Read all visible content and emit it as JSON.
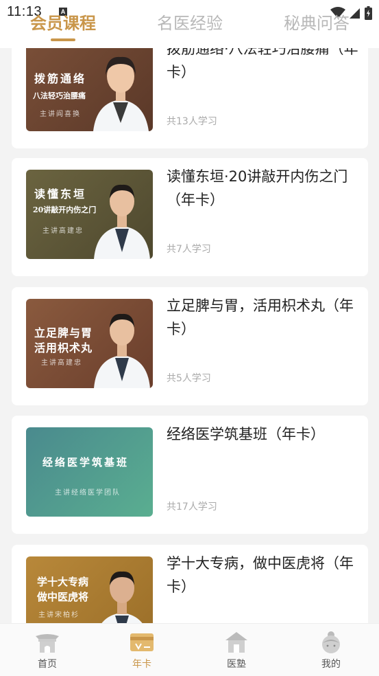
{
  "status_bar": {
    "time": "11:13",
    "notification_badge": "A"
  },
  "header": {
    "tabs": [
      {
        "label": "会员课程",
        "active": true
      },
      {
        "label": "名医经验",
        "active": false
      },
      {
        "label": "秘典问答",
        "active": false
      }
    ],
    "accent_color": "#c9964a"
  },
  "courses": [
    {
      "title": "拨筋通络·八法轻巧治腰痛（年卡）",
      "count": "共13人学习",
      "thumb": {
        "title": "拨筋通络",
        "subtitle": "八法轻巧治腰痛",
        "lecturer": "主讲阎喜换",
        "color": "#6b4432",
        "doctor_icon": "female-doctor-icon"
      }
    },
    {
      "title": "读懂东垣·20讲敲开内伤之门（年卡）",
      "count": "共7人学习",
      "thumb": {
        "title": "读懂东垣",
        "subtitle": "20讲敲开内伤之门",
        "lecturer": "主讲高建忠",
        "color": "#5e5637",
        "doctor_icon": "male-doctor-icon"
      }
    },
    {
      "title": "立足脾与胃，活用枳术丸（年卡）",
      "count": "共5人学习",
      "thumb": {
        "title": "立足脾与胃",
        "subtitle": "活用枳术丸",
        "lecturer": "主讲高建忠",
        "color": "#7a4b35",
        "doctor_icon": "male-doctor-icon"
      }
    },
    {
      "title": "经络医学筑基班（年卡）",
      "count": "共17人学习",
      "thumb": {
        "title": "经络医学筑基班",
        "subtitle": "",
        "lecturer": "主讲经络医学团队",
        "color": "#4b8f8c",
        "doctor_icon": ""
      }
    },
    {
      "title": "学十大专病，做中医虎将（年卡）",
      "count": "",
      "thumb": {
        "title": "学十大专病",
        "subtitle": "做中医虎将",
        "lecturer": "主讲宋柏杉",
        "color": "#a8782e",
        "doctor_icon": "male-doctor-icon"
      }
    }
  ],
  "bottom_nav": [
    {
      "label": "首页",
      "icon": "home-gate-icon",
      "active": false
    },
    {
      "label": "年卡",
      "icon": "card-icon",
      "active": true
    },
    {
      "label": "医塾",
      "icon": "school-house-icon",
      "active": false
    },
    {
      "label": "我的",
      "icon": "profile-icon",
      "active": false
    }
  ]
}
